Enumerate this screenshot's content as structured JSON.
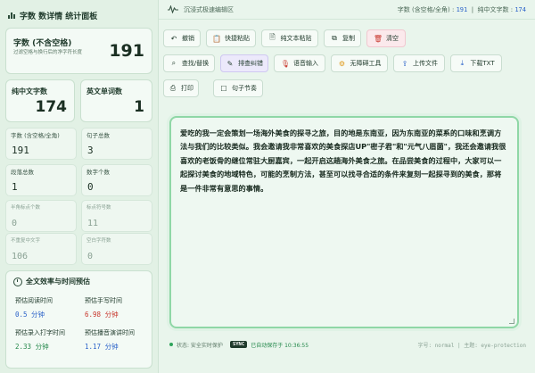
{
  "sidebar": {
    "title": "字数 数详情 统计面板",
    "title_main": "字",
    "title_rest": "数详情",
    "title_tail": "统计面板",
    "total": {
      "label": "字数 (不含空格)",
      "sub": "过滤空格与换行后的净字符长度",
      "value": "191"
    },
    "pure_chinese": {
      "label": "纯中文字数",
      "value": "174"
    },
    "english_words": {
      "label": "英文单词数",
      "value": "1"
    },
    "stats": [
      {
        "label": "字数 (含空格/全角)",
        "value": "191"
      },
      {
        "label": "句子总数",
        "value": "3"
      },
      {
        "label": "段落总数",
        "value": "1"
      },
      {
        "label": "数字个数",
        "value": "0"
      },
      {
        "label": "半角标点个数",
        "value": "0"
      },
      {
        "label": "标点符号数",
        "value": "11"
      },
      {
        "label": "不重复中文字",
        "value": "106"
      },
      {
        "label": "空白字符数",
        "value": "0"
      }
    ],
    "efficiency": {
      "title": "全文效率与时间预估",
      "items": [
        {
          "label": "预估阅读时间",
          "value": "0.5 分钟",
          "color": "#2b62c9"
        },
        {
          "label": "预估手写时间",
          "value": "6.98 分钟",
          "color": "#c8372d"
        },
        {
          "label": "预估录入打字时间",
          "value": "2.33 分钟",
          "color": "#24884b"
        },
        {
          "label": "预估播音演讲时间",
          "value": "1.17 分钟",
          "color": "#2b62c9"
        }
      ]
    }
  },
  "topbar": {
    "title": "沉浸式极速编辑区",
    "count_label": "字数 (含空格/全角) :",
    "count_value": "191",
    "chinese_label": "纯中文字数 :",
    "chinese_value": "174"
  },
  "toolbar": {
    "undo": "撤销",
    "paste": "快捷粘贴",
    "plain_paste": "纯文本粘贴",
    "copy": "复制",
    "clear": "清空",
    "find_replace": "查找/替换",
    "format": "排查纠错",
    "voice": "语音输入",
    "accessibility": "无障碍工具",
    "upload": "上传文件",
    "download": "下载TXT",
    "print": "打印",
    "rhythm": "句子节奏"
  },
  "editor": {
    "content": "爱吃的我一定会策划一场海外美食的探寻之旅，目的地是东南亚，因为东南亚的菜系的口味和烹调方法与我们的比较类似。我会邀请我非常喜欢的美食探店UP\"密子君\"和\"元气八眉菌\"，我还会邀请我很喜欢的老饭骨的继位常驻大厨嘉宾，一起开启这趟海外美食之旅。在品尝美食的过程中，大家可以一起探讨美食的地域特色，可能的烹制方法，甚至可以找寻合适的条件来复刻一起探寻到的美食，那将是一件非常有意思的事情。"
  },
  "status": {
    "state": "状态: 安全实时保护",
    "sync_badge": "SYNC",
    "saved": "已自动保存于 10:36:55",
    "right": "字号: normal | 主题: eye-protection"
  },
  "colors": {
    "accent_blue": "#2b62c9",
    "accent_red": "#c8372d",
    "accent_green": "#24884b",
    "editor_border": "#8fd7a6"
  }
}
